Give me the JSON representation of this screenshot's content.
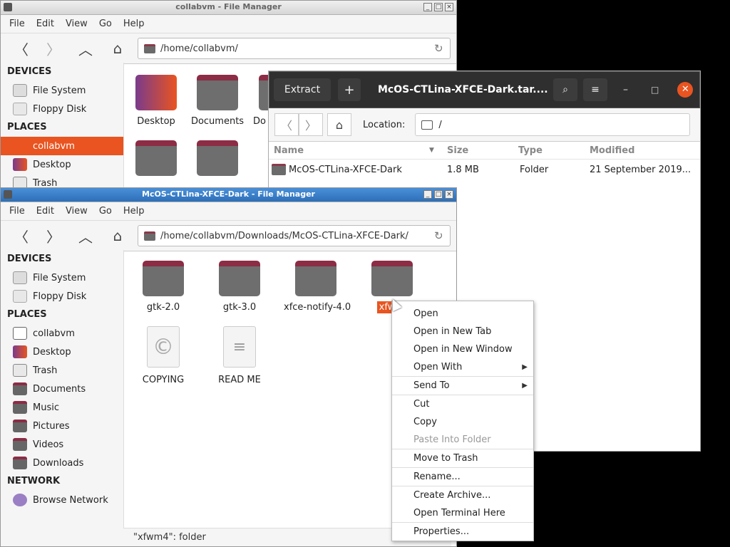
{
  "back_window": {
    "title": "collabvm - File Manager",
    "menu": [
      "File",
      "Edit",
      "View",
      "Go",
      "Help"
    ],
    "path": "/home/collabvm/",
    "devices_header": "DEVICES",
    "devices": [
      "File System",
      "Floppy Disk"
    ],
    "places_header": "PLACES",
    "places": [
      "collabvm",
      "Desktop",
      "Trash"
    ],
    "files": [
      "Desktop",
      "Documents",
      "Do"
    ]
  },
  "archive": {
    "extract_label": "Extract",
    "add_label": "+",
    "title": "McOS-CTLina-XFCE-Dark.tar....",
    "location_label": "Location:",
    "location_value": "/",
    "columns": [
      "Name",
      "Size",
      "Type",
      "Modified"
    ],
    "rows": [
      {
        "name": "McOS-CTLina-XFCE-Dark",
        "size": "1.8 MB",
        "type": "Folder",
        "modified": "21 September 2019..."
      }
    ]
  },
  "front_window": {
    "title": "McOS-CTLina-XFCE-Dark - File Manager",
    "menu": [
      "File",
      "Edit",
      "View",
      "Go",
      "Help"
    ],
    "path": "/home/collabvm/Downloads/McOS-CTLina-XFCE-Dark/",
    "devices_header": "DEVICES",
    "devices": [
      "File System",
      "Floppy Disk"
    ],
    "places_header": "PLACES",
    "places": [
      "collabvm",
      "Desktop",
      "Trash",
      "Documents",
      "Music",
      "Pictures",
      "Videos",
      "Downloads"
    ],
    "network_header": "NETWORK",
    "network": [
      "Browse Network"
    ],
    "files": [
      "gtk-2.0",
      "gtk-3.0",
      "xfce-notify-4.0",
      "xfw"
    ],
    "docs": [
      "COPYING",
      "READ ME"
    ],
    "status": "\"xfwm4\": folder"
  },
  "context_menu": [
    "Open",
    "Open in New Tab",
    "Open in New Window",
    "Open With",
    "Send To",
    "Cut",
    "Copy",
    "Paste Into Folder",
    "Move to Trash",
    "Rename...",
    "Create Archive...",
    "Open Terminal Here",
    "Properties..."
  ],
  "colors": {
    "accent": "#e95420",
    "folder_tab": "#8c2c45"
  }
}
